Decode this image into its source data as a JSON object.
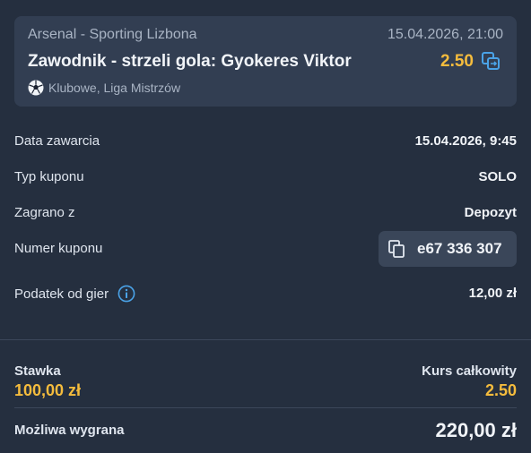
{
  "event": {
    "match": "Arsenal - Sporting Lizbona",
    "datetime": "15.04.2026, 21:00",
    "pick": "Zawodnik - strzeli gola: Gyokeres Viktor",
    "odds": "2.50",
    "league": "Klubowe, Liga Mistrzów",
    "sport_icon": "soccer-ball-icon",
    "odds_icon": "switch-icon"
  },
  "details": {
    "closed_label": "Data zawarcia",
    "closed_value": "15.04.2026, 9:45",
    "type_label": "Typ kuponu",
    "type_value": "SOLO",
    "source_label": "Zagrano z",
    "source_value": "Depozyt",
    "coupon_label": "Numer kuponu",
    "coupon_value": "e67 336 307",
    "tax_label": "Podatek od gier",
    "tax_value": "12,00 zł"
  },
  "summary": {
    "stake_label": "Stawka",
    "stake_value": "100,00 zł",
    "total_odds_label": "Kurs całkowity",
    "total_odds_value": "2.50",
    "win_label": "Możliwa wygrana",
    "win_value": "220,00 zł"
  },
  "colors": {
    "background": "#252f3f",
    "card": "#323e52",
    "accent": "#f5bc3d",
    "info": "#4aa3e8"
  }
}
